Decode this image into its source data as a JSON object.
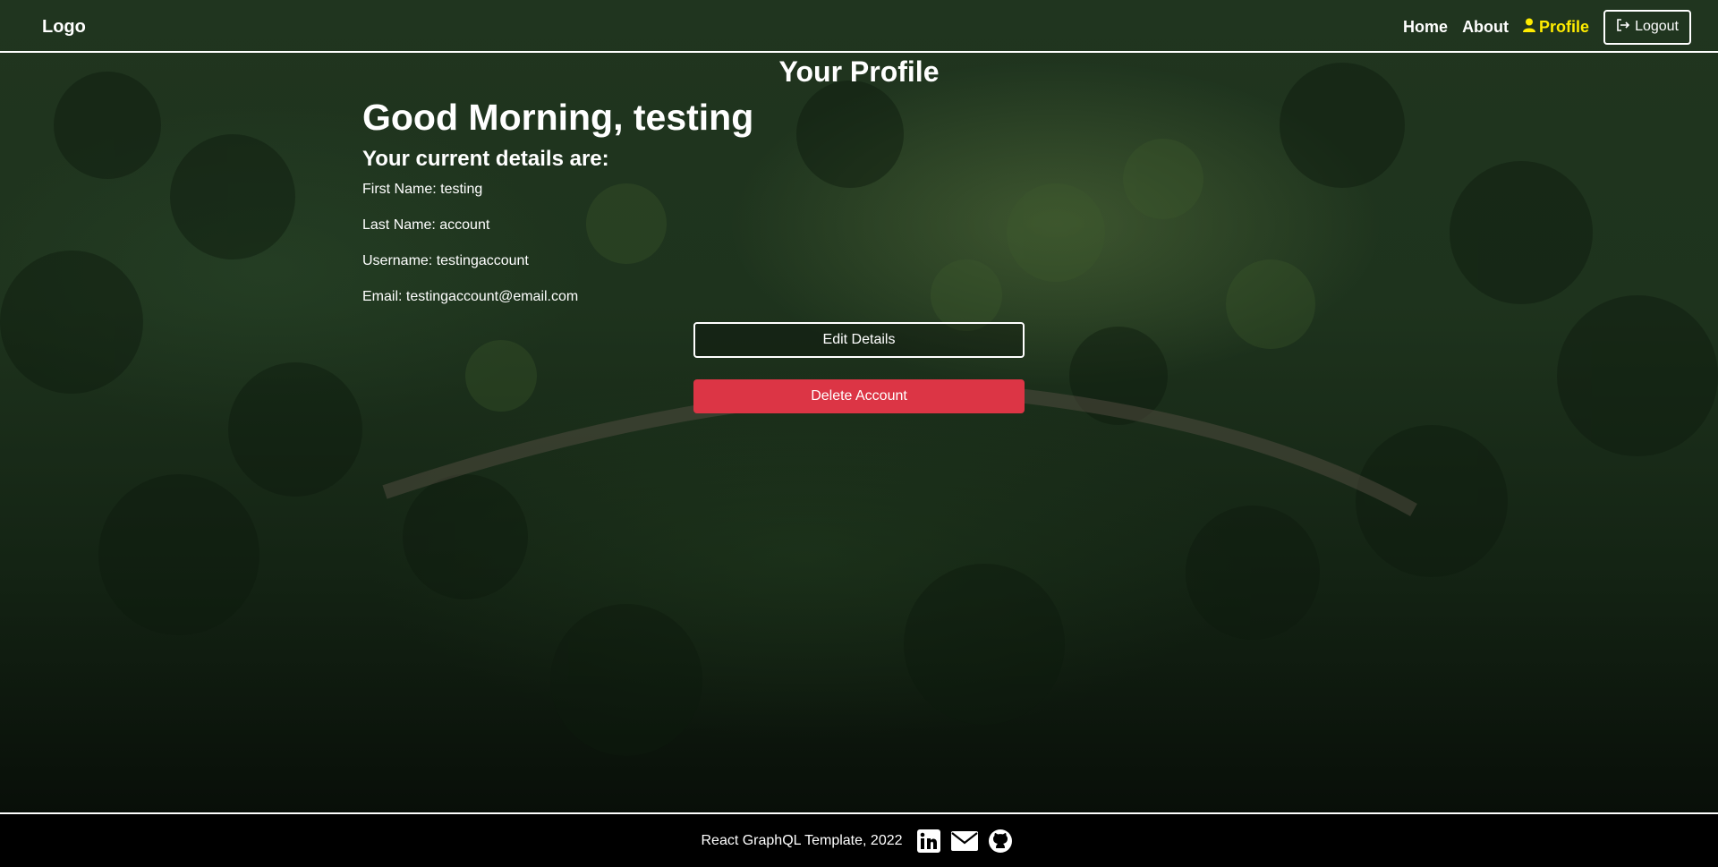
{
  "nav": {
    "logo": "Logo",
    "links": [
      {
        "label": "Home",
        "icon": ""
      },
      {
        "label": "About",
        "icon": ""
      },
      {
        "label": "Profile",
        "icon": "user-icon",
        "active": true
      }
    ],
    "logout_label": "Logout",
    "logout_icon": "sign-out-icon"
  },
  "page": {
    "title": "Your Profile",
    "greeting": "Good Morning, testing",
    "details_heading": "Your current details are:",
    "details": [
      "First Name: testing",
      "Last Name: account",
      "Username: testingaccount",
      "Email: testingaccount@email.com"
    ]
  },
  "buttons": {
    "edit": "Edit Details",
    "delete": "Delete Account"
  },
  "footer": {
    "text": "React GraphQL Template, 2022",
    "icons": [
      "linkedin-icon",
      "email-icon",
      "github-icon"
    ]
  },
  "colors": {
    "active_link": "#ffec00",
    "danger": "#dc3545",
    "footer_bg": "#000000"
  }
}
